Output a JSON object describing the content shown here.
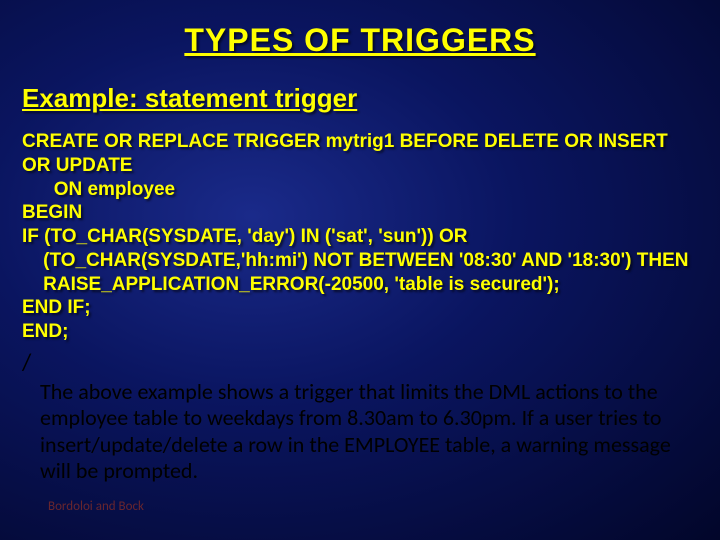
{
  "title": "TYPES OF TRIGGERS",
  "subtitle": "Example: statement trigger",
  "code": "CREATE OR REPLACE TRIGGER mytrig1 BEFORE DELETE OR INSERT OR UPDATE\n      ON employee\nBEGIN\nIF (TO_CHAR(SYSDATE, 'day') IN ('sat', 'sun')) OR\n    (TO_CHAR(SYSDATE,'hh:mi') NOT BETWEEN '08:30' AND '18:30') THEN\n    RAISE_APPLICATION_ERROR(-20500, 'table is secured');\nEND IF;\nEND;",
  "slash": "/",
  "explanation": "The above example shows a trigger that limits the DML actions to the employee table to weekdays from 8.30am to 6.30pm. If a user tries to insert/update/delete a row in the EMPLOYEE table, a warning message will be prompted.",
  "footer": "Bordoloi and Bock"
}
